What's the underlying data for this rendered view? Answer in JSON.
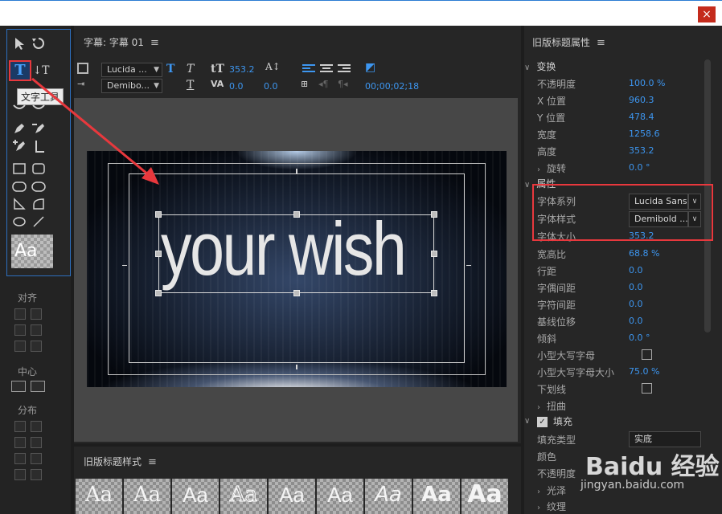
{
  "window": {
    "close_label": "×"
  },
  "tools": {
    "tooltip": "文字工具",
    "type_tool_label": "T",
    "vertical_type_label": "↓T",
    "style_preview": "Aa",
    "align_label": "对齐",
    "center_label": "中心",
    "distribute_label": "分布"
  },
  "title_panel": {
    "title": "字幕: 字幕 01",
    "font_family": "Lucida ...",
    "font_style": "Demibo...",
    "font_size": "353.2",
    "kerning": "0.0",
    "leading": "0.0",
    "timecode": "00;00;02;18",
    "canvas_text": "your wish"
  },
  "styles_panel": {
    "title": "旧版标题样式",
    "tiles": [
      "Aa",
      "Aa",
      "Aa",
      "Aa",
      "Aa",
      "Aa",
      "Aa",
      "Aa",
      "Aa"
    ]
  },
  "properties": {
    "title": "旧版标题属性",
    "transform_section": "变换",
    "transform": [
      {
        "label": "不透明度",
        "value": "100.0 %"
      },
      {
        "label": "X 位置",
        "value": "960.3"
      },
      {
        "label": "Y 位置",
        "value": "478.4"
      },
      {
        "label": "宽度",
        "value": "1258.6"
      },
      {
        "label": "高度",
        "value": "353.2"
      }
    ],
    "rotation_label": "旋转",
    "rotation_value": "0.0 °",
    "attributes_section": "属性",
    "font_family_label": "字体系列",
    "font_family_value": "Lucida Sans",
    "font_style_label": "字体样式",
    "font_style_value": "Demibold ...",
    "font_size_label": "字体大小",
    "font_size_value": "353.2",
    "attributes": [
      {
        "label": "宽高比",
        "value": "68.8 %"
      },
      {
        "label": "行距",
        "value": "0.0"
      },
      {
        "label": "字偶间距",
        "value": "0.0"
      },
      {
        "label": "字符间距",
        "value": "0.0"
      },
      {
        "label": "基线位移",
        "value": "0.0"
      },
      {
        "label": "倾斜",
        "value": "0.0 °"
      }
    ],
    "small_caps_label": "小型大写字母",
    "small_caps_size_label": "小型大写字母大小",
    "small_caps_size_value": "75.0 %",
    "underline_label": "下划线",
    "distort_label": "扭曲",
    "fill_section": "填充",
    "fill_type_label": "填充类型",
    "fill_type_value": "实底",
    "color_label": "颜色",
    "opacity_label": "不透明度",
    "sheen_label": "光泽",
    "texture_label": "纹理"
  },
  "watermark": {
    "brand": "Baidu 经验",
    "url": "jingyan.baidu.com"
  },
  "colors": {
    "accent_blue": "#3d96f0",
    "highlight_red": "#e8383d"
  }
}
